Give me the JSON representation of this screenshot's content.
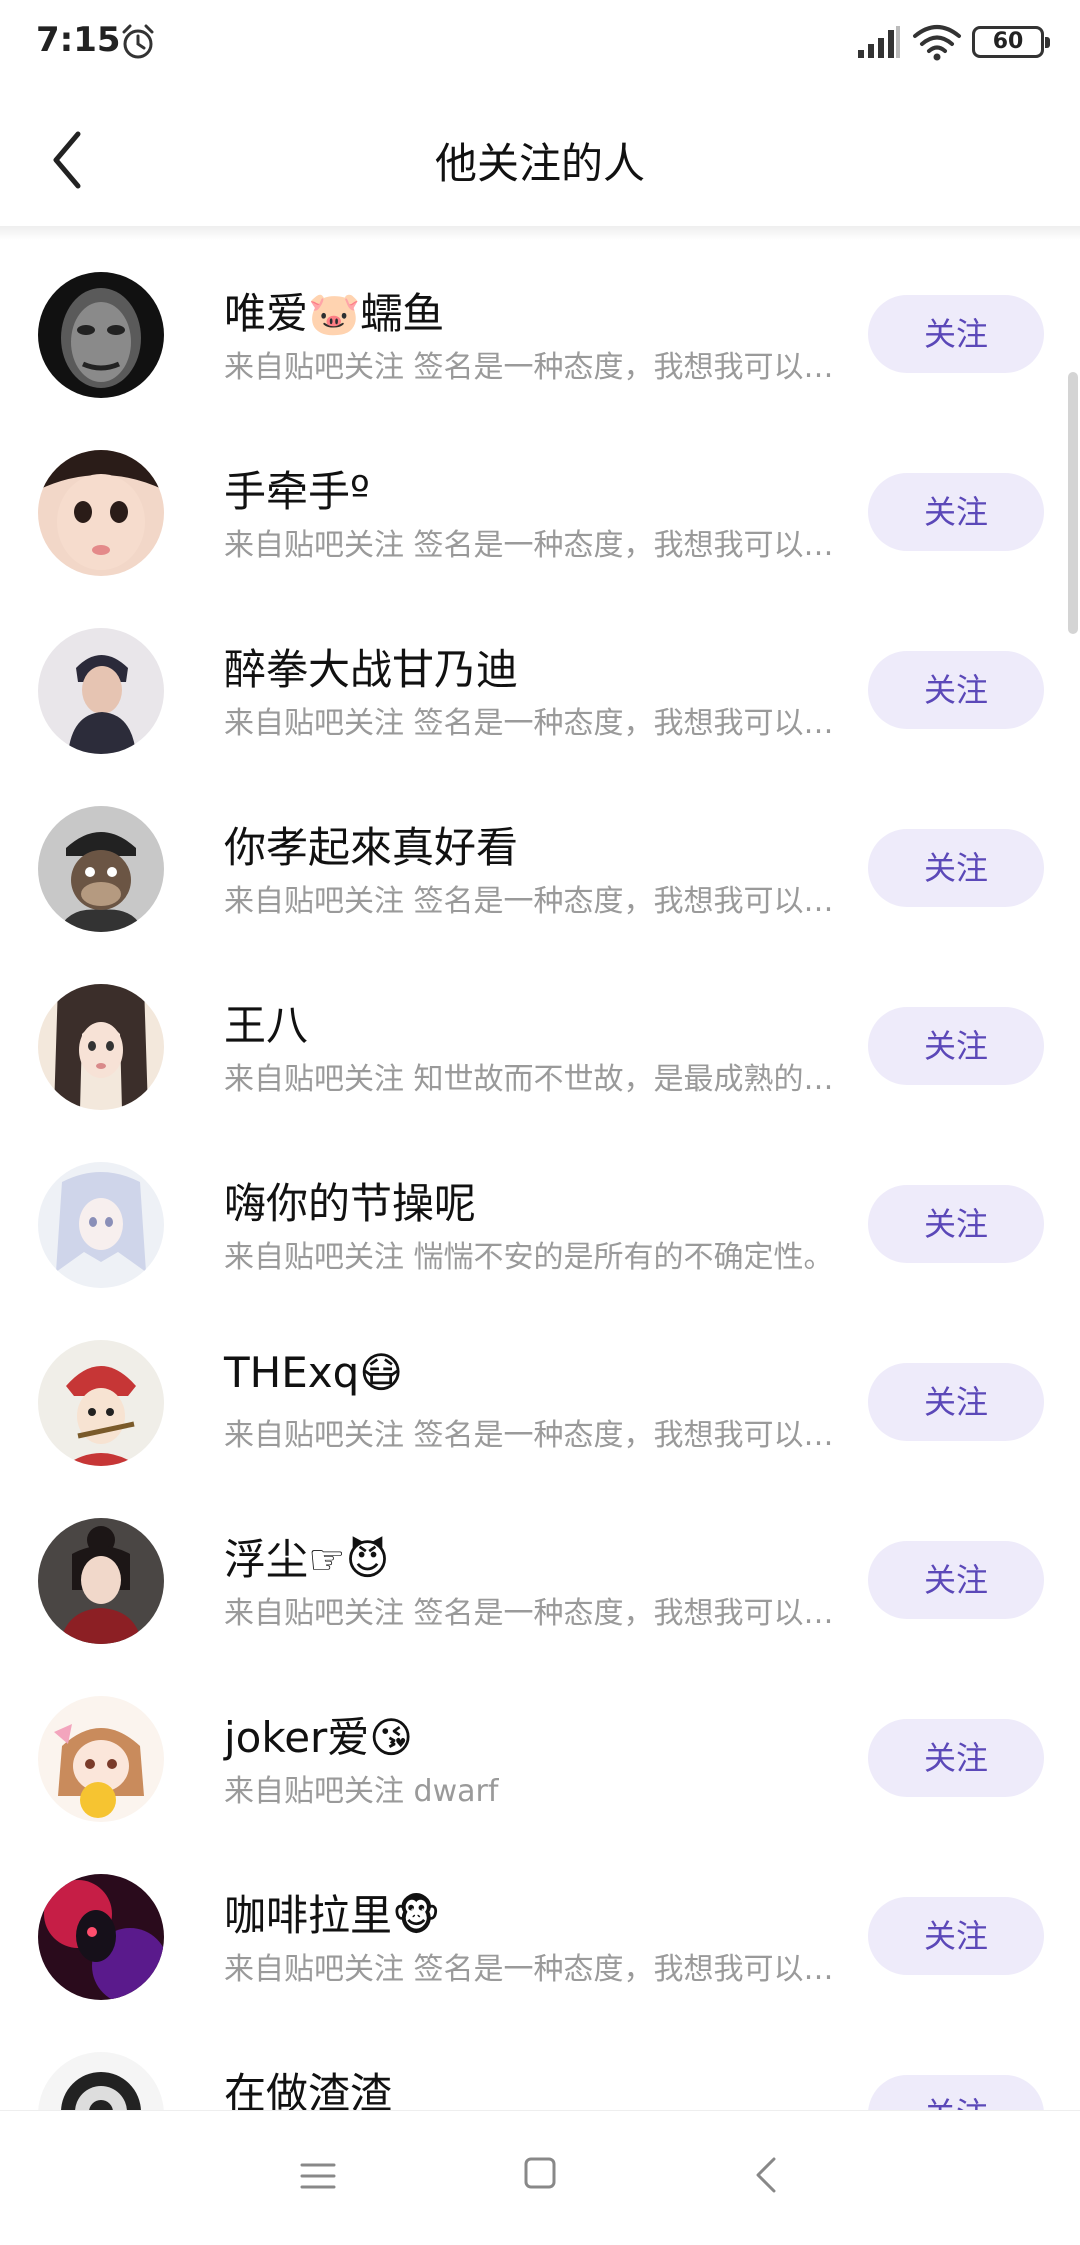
{
  "status_bar": {
    "time": "7:15",
    "battery": "60"
  },
  "header": {
    "title": "他关注的人"
  },
  "follow_label": "关注",
  "users": [
    {
      "name": "唯爱🐷蠕鱼",
      "desc": "来自贴吧关注 签名是一种态度，我想我可以…"
    },
    {
      "name": "手牵手º",
      "desc": "来自贴吧关注 签名是一种态度，我想我可以…"
    },
    {
      "name": "醉拳大战甘乃迪",
      "desc": "来自贴吧关注 签名是一种态度，我想我可以…"
    },
    {
      "name": "你孝起來真好看",
      "desc": "来自贴吧关注 签名是一种态度，我想我可以…"
    },
    {
      "name": "王八",
      "desc": "来自贴吧关注 知世故而不世故，是最成熟的…"
    },
    {
      "name": "嗨你的节操呢",
      "desc": "来自贴吧关注 惴惴不安的是所有的不确定性。"
    },
    {
      "name": "THExq😷",
      "desc": "来自贴吧关注 签名是一种态度，我想我可以…"
    },
    {
      "name": "浮尘☞😈",
      "desc": "来自贴吧关注 签名是一种态度，我想我可以…"
    },
    {
      "name": "joker爱😘",
      "desc": "来自贴吧关注 dwarf"
    },
    {
      "name": "咖啡拉里🐵",
      "desc": "来自贴吧关注 签名是一种态度，我想我可以…"
    },
    {
      "name": "在做渣渣",
      "desc": ""
    }
  ],
  "colors": {
    "follow_bg": "#eeebfa",
    "follow_text": "#5b48b8",
    "desc_text": "#9a9a9a"
  }
}
